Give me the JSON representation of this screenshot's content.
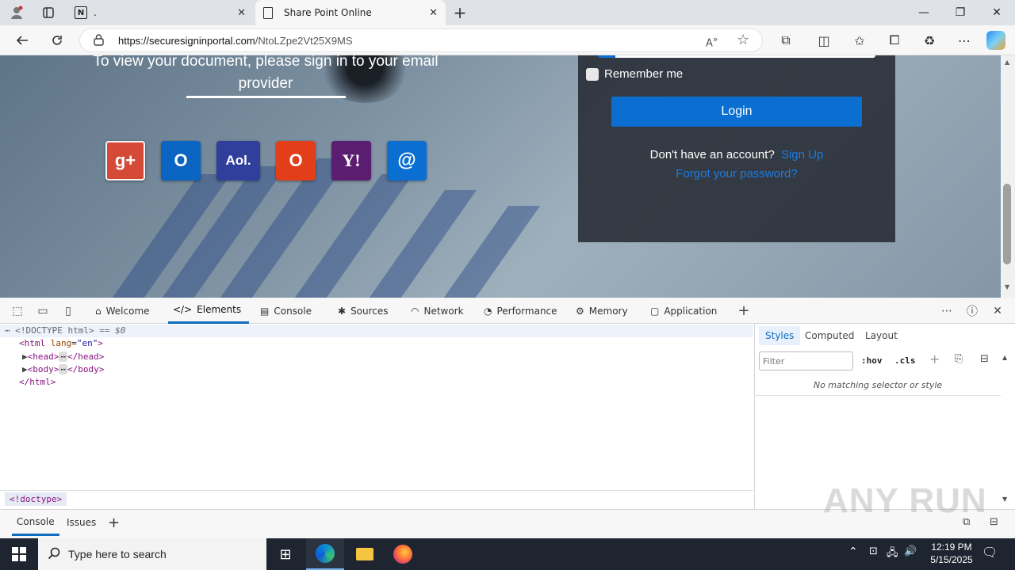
{
  "browser": {
    "tabs": [
      {
        "title": ".",
        "active": false
      },
      {
        "title": "Share Point Online",
        "active": true
      }
    ],
    "url_host": "https://securesigninportal.com",
    "url_path": "/NtoLZpe2Vt25X9MS"
  },
  "page": {
    "heading": "To view your document, please sign in to your email provider",
    "providers": [
      {
        "name": "google-plus-icon",
        "glyph": "g+",
        "color": "#d54937"
      },
      {
        "name": "outlook-icon",
        "glyph": "O",
        "color": "#0a64c2"
      },
      {
        "name": "aol-icon",
        "glyph": "Aol.",
        "color": "#2f3f9b"
      },
      {
        "name": "office-icon",
        "glyph": "O",
        "color": "#e23e1a"
      },
      {
        "name": "yahoo-icon",
        "glyph": "Y!",
        "color": "#5a1d6f"
      },
      {
        "name": "email-icon",
        "glyph": "@",
        "color": "#0b6fd1"
      }
    ],
    "remember_label": "Remember me",
    "login_label": "Login",
    "no_account_text": "Don't have an account?",
    "signup_link": "Sign Up",
    "forgot_link": "Forgot your password?"
  },
  "devtools": {
    "tabs": [
      "Welcome",
      "Elements",
      "Console",
      "Sources",
      "Network",
      "Performance",
      "Memory",
      "Application"
    ],
    "active_tab": "Elements",
    "dom": {
      "doctype": "<!DOCTYPE html>",
      "doctype_suffix": " == $0",
      "html_open_tag": "html",
      "lang_attr": "lang",
      "lang_val": "\"en\"",
      "head_open": "<head>",
      "head_close": "</head>",
      "body_open": "<body>",
      "body_close": "</body>",
      "html_close": "</html>"
    },
    "side_tabs": [
      "Styles",
      "Computed",
      "Layout"
    ],
    "filter_placeholder": "Filter",
    "hov": ":hov",
    "cls": ".cls",
    "no_match": "No matching selector or style",
    "breadcrumb": "<!doctype>",
    "drawer_tabs": [
      "Console",
      "Issues"
    ]
  },
  "taskbar": {
    "search_placeholder": "Type here to search",
    "time": "12:19 PM",
    "date": "5/15/2025"
  },
  "watermark": "ANY RUN"
}
